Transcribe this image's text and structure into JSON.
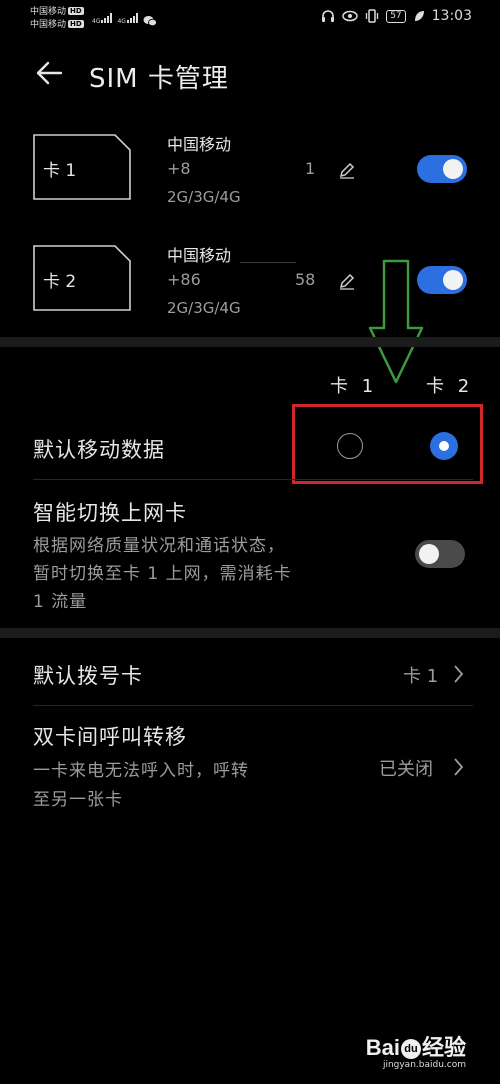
{
  "status_bar": {
    "carrier_1": "中国移动",
    "carrier_2": "中国移动",
    "hd": "HD",
    "net_label": "4G",
    "battery": "57",
    "time": "13:03"
  },
  "header": {
    "title": "SIM 卡管理"
  },
  "sims": [
    {
      "slot_label": "卡 1",
      "carrier": "中国移动",
      "number_prefix": "+8",
      "number_suffix": "1",
      "network": "2G/3G/4G",
      "enabled": true
    },
    {
      "slot_label": "卡 2",
      "carrier": "中国移动",
      "number_prefix": "+86",
      "number_suffix": "58",
      "network": "2G/3G/4G",
      "enabled": true
    }
  ],
  "default_data": {
    "col_1": "卡 1",
    "col_2": "卡 2",
    "label": "默认移动数据",
    "selected": "卡 2"
  },
  "smart_switch": {
    "title": "智能切换上网卡",
    "desc_line_1": "根据网络质量状况和通话状态，",
    "desc_line_2": "暂时切换至卡 1 上网，需消耗卡",
    "desc_line_3": "1 流量",
    "enabled": false
  },
  "default_dial": {
    "title": "默认拨号卡",
    "value": "卡 1"
  },
  "call_forward": {
    "title": "双卡间呼叫转移",
    "desc_line_1": "一卡来电无法呼入时，呼转",
    "desc_line_2": "至另一张卡",
    "value": "已关闭"
  },
  "colors": {
    "accent": "#2b6fe0",
    "annotation_arrow": "#3c9a3c",
    "annotation_box": "#d0282a"
  },
  "watermark": {
    "logo_left": "Bai",
    "logo_right": "经验",
    "url": "jingyan.baidu.com"
  }
}
